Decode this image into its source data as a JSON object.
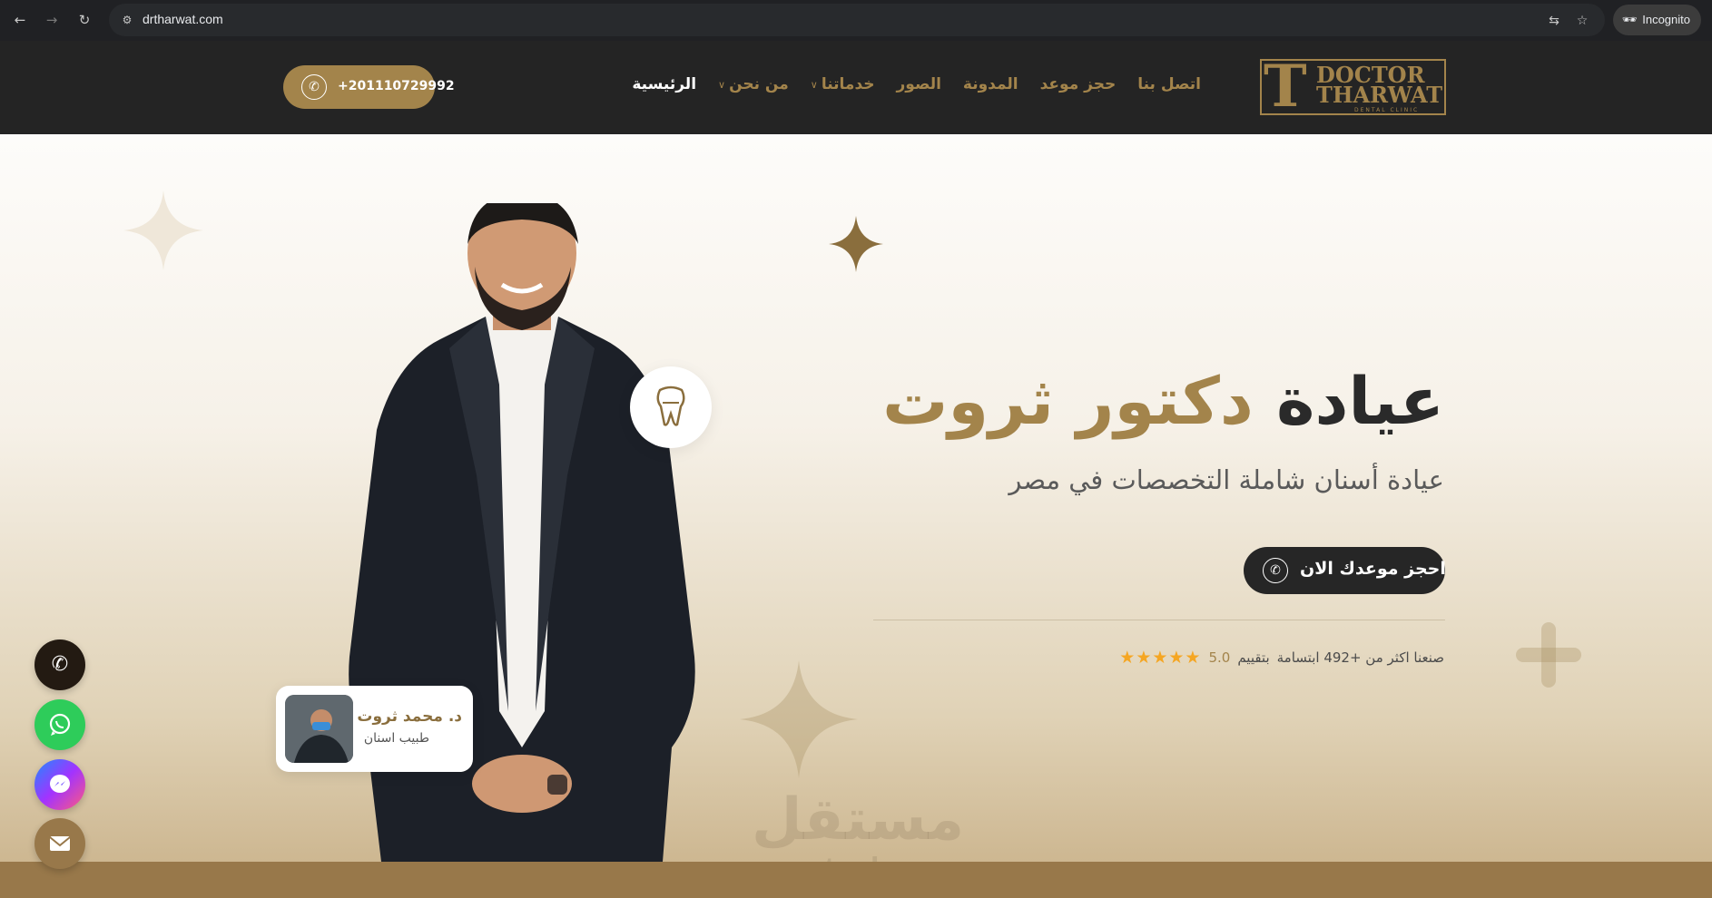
{
  "browser": {
    "url": "drtharwat.com",
    "incognito_label": "Incognito"
  },
  "header": {
    "logo": {
      "big_letter": "T",
      "line1": "DOCTOR",
      "line2": "THARWAT",
      "line3": "DENTAL CLINIC"
    },
    "nav": [
      {
        "label": "الرئيسية",
        "active": true,
        "dropdown": false
      },
      {
        "label": "من نحن",
        "active": false,
        "dropdown": true
      },
      {
        "label": "خدماتنا",
        "active": false,
        "dropdown": true
      },
      {
        "label": "الصور",
        "active": false,
        "dropdown": false
      },
      {
        "label": "المدونة",
        "active": false,
        "dropdown": false
      },
      {
        "label": "حجز موعد",
        "active": false,
        "dropdown": false
      },
      {
        "label": "اتصل بنا",
        "active": false,
        "dropdown": false
      }
    ],
    "phone": "+201110729992"
  },
  "hero": {
    "title_part1": "عيادة",
    "title_part2": "دكتور ثروت",
    "subtitle": "عيادة أسنان شاملة التخصصات في مصر",
    "cta_label": "احجز موعدك الان",
    "rating_text1": "صنعنا اكثر من +492 ابتسامة",
    "rating_text2": "بتقييم",
    "rating_score": "5.0",
    "stars": "★★★★★",
    "doctor_card": {
      "name": "د. محمد ثروت",
      "role": "طبيب اسنان"
    }
  },
  "floating_buttons": [
    {
      "icon": "phone-icon",
      "color": "#231a12"
    },
    {
      "icon": "whatsapp-icon",
      "color": "#2ecc5a"
    },
    {
      "icon": "messenger-icon",
      "color": "#7b5cff"
    },
    {
      "icon": "mail-icon",
      "color": "#98784a"
    }
  ],
  "watermark": {
    "arabic": "مستقل",
    "latin": "mostaql.com"
  },
  "colors": {
    "brand_gold": "#a3844b",
    "dark": "#242424"
  }
}
